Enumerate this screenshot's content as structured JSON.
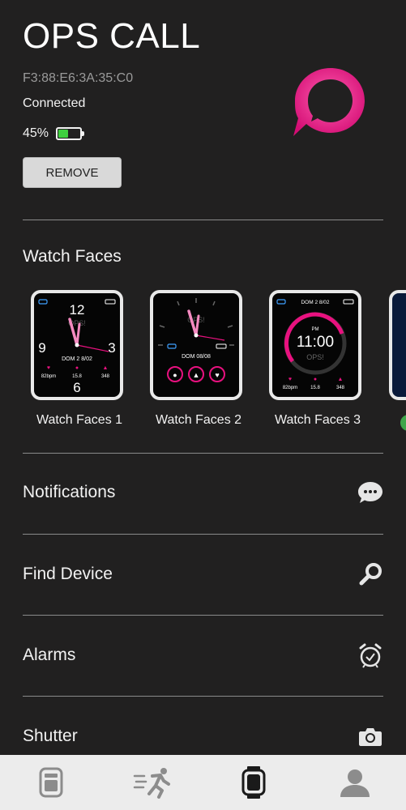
{
  "device": {
    "name": "OPS CALL",
    "mac": "F3:88:E6:3A:35:C0",
    "status": "Connected",
    "battery_label": "45%",
    "battery_level": 0.45,
    "remove_label": "REMOVE"
  },
  "watch_faces": {
    "title": "Watch Faces",
    "items": [
      {
        "label": "Watch Faces 1",
        "numerals": [
          "12",
          "3",
          "6",
          "9"
        ],
        "brand": "OPS!",
        "date": "DOM 2 8/02",
        "stats": [
          "82bpm",
          "15.8",
          "348"
        ]
      },
      {
        "label": "Watch Faces 2",
        "brand": "OPS!",
        "date": "DOM 08/08"
      },
      {
        "label": "Watch Faces 3",
        "date": "DOM 2 8/02",
        "ampm": "PM",
        "time": "11:00",
        "brand": "OPS!",
        "stats": [
          "82bpm",
          "15.8",
          "348"
        ]
      }
    ]
  },
  "menu": {
    "notifications": "Notifications",
    "find_device": "Find Device",
    "alarms": "Alarms",
    "shutter": "Shutter"
  },
  "colors": {
    "background": "#212020",
    "accent_pink": "#e8117f",
    "battery_green": "#3fcf3f",
    "nav_bg": "#ececec"
  },
  "icons": {
    "app_logo": "chat-bubble-icon",
    "notifications": "chat-dots-icon",
    "find_device": "magnifier-icon",
    "alarms": "alarm-clock-icon",
    "shutter": "camera-icon",
    "nav": [
      "watch-card-icon",
      "running-icon",
      "smartwatch-icon",
      "user-icon"
    ]
  }
}
